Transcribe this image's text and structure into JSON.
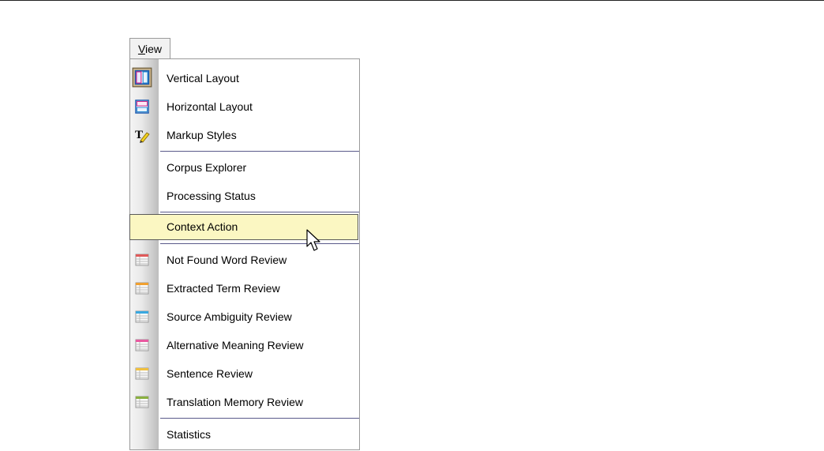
{
  "menu": {
    "title": "View",
    "title_accelerator": "V",
    "title_rest": "iew",
    "items": [
      {
        "label": "Vertical Layout",
        "icon": "vertical-layout-icon"
      },
      {
        "label": "Horizontal Layout",
        "icon": "horizontal-layout-icon"
      },
      {
        "label": "Markup Styles",
        "icon": "markup-styles-icon"
      },
      {
        "label": "Corpus Explorer"
      },
      {
        "label": "Processing Status"
      },
      {
        "label": "Context Action",
        "state": "highlighted"
      },
      {
        "label": "Not Found Word Review",
        "icon": "review-grid-icon",
        "color": "#e05a5a"
      },
      {
        "label": "Extracted Term Review",
        "icon": "review-grid-icon",
        "color": "#f0a030"
      },
      {
        "label": "Source Ambiguity Review",
        "icon": "review-grid-icon",
        "color": "#3aa8e0"
      },
      {
        "label": "Alternative Meaning Review",
        "icon": "review-grid-icon",
        "color": "#e85aa0"
      },
      {
        "label": "Sentence Review",
        "icon": "review-grid-icon",
        "color": "#f0c040"
      },
      {
        "label": "Translation Memory Review",
        "icon": "review-grid-icon",
        "color": "#8ab040"
      },
      {
        "label": "Statistics"
      }
    ]
  },
  "colors": {
    "highlight_bg": "#fbf7c2",
    "separator": "#5a5a8a"
  }
}
